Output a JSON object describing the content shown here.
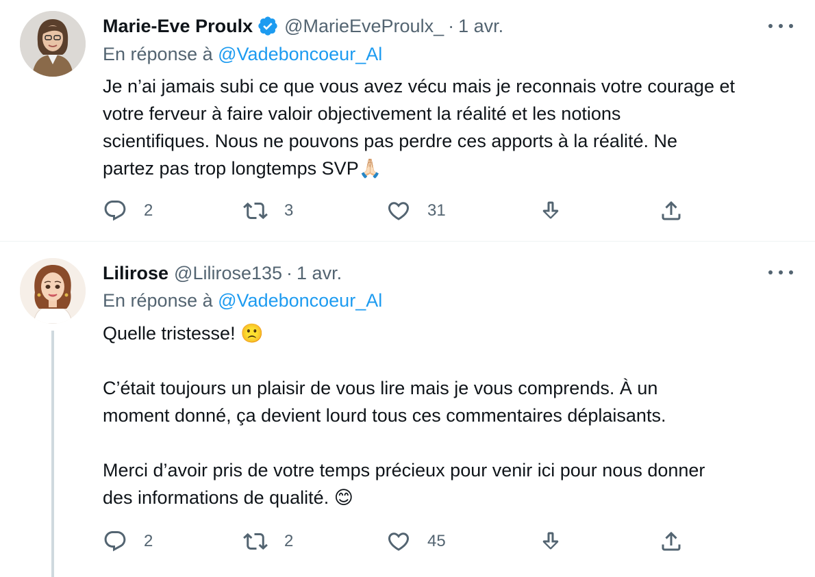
{
  "tweets": [
    {
      "name": "Marie-Eve Proulx",
      "verified": true,
      "handle": "@MarieEveProulx_",
      "separator": "·",
      "time": "1 avr.",
      "reply_prefix": "En réponse à",
      "reply_mention": "@Vadeboncoeur_Al",
      "lines": [
        "Je n’ai jamais subi ce que vous avez vécu mais je reconnais votre courage et",
        "votre ferveur à faire valoir objectivement la réalité et les notions",
        "scientifiques. Nous ne pouvons pas perdre ces apports à la réalité. Ne",
        "partez pas trop longtemps SVP"
      ],
      "emoji": "🙏🏻",
      "replies": "2",
      "retweets": "3",
      "likes": "31",
      "icons": [
        "reply-icon",
        "retweet-icon",
        "like-icon",
        "download-icon",
        "share-icon",
        "more-icon",
        "verified-badge-icon"
      ]
    },
    {
      "name": "Lilirose",
      "verified": false,
      "handle": "@Lilirose135",
      "separator": "·",
      "time": "1 avr.",
      "reply_prefix": "En réponse à",
      "reply_mention": "@Vadeboncoeur_Al",
      "para1": "Quelle tristesse!",
      "para1_emoji": "🙁",
      "para2_line1": "C’était toujours un plaisir de vous lire mais je vous comprends. À un",
      "para2_line2": "moment donné, ça devient lourd tous ces commentaires déplaisants.",
      "para3_line1": "Merci d’avoir pris de votre temps précieux pour venir ici pour nous donner",
      "para3_line2": "des informations de qualité.",
      "para3_emoji": "😊",
      "replies": "2",
      "retweets": "2",
      "likes": "45"
    }
  ],
  "colors": {
    "text": "#0f1419",
    "secondary": "#536471",
    "link": "#1d9bf0",
    "divider": "#eff3f4",
    "thread_line": "#cfd9de"
  }
}
